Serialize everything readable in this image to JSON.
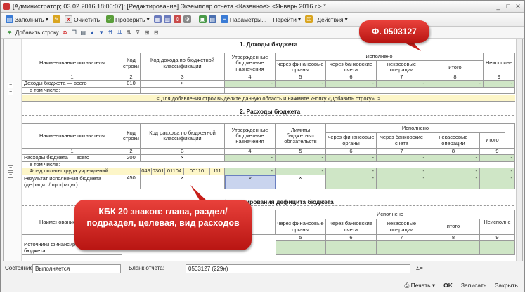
{
  "window": {
    "title": "[Администратор; 03.02.2016 18:06:07]: [Редактирование] Экземпляр отчета <Казенное> <Январь 2016 г.> *"
  },
  "toolbar": {
    "fill": "Заполнить",
    "clear": "Очистить",
    "check": "Проверить",
    "params": "Параметры...",
    "goto": "Перейти",
    "actions": "Действия"
  },
  "subtoolbar": {
    "add_row": "Добавить строку"
  },
  "sections": {
    "s1": "1. Доходы бюджета",
    "s2": "2. Расходы бюджета",
    "s3": "3. Источники финансирования дефицита бюджета"
  },
  "headers": {
    "name": "Наименование показателя",
    "code_line": "Код строки",
    "income_code": "Код дохода по бюджетной классификации",
    "expense_code": "Код расхода по бюджетной классификации",
    "approved": "Утвержденные бюджетные назначения",
    "limits": "Лимиты бюджетных обязательств",
    "executed": "Исполнено",
    "via_fin": "через финансовые органы",
    "via_bank": "через банковские счета",
    "noncash": "некассовые операции",
    "total": "итого",
    "unexecuted": "Неисполне"
  },
  "colnums1": [
    "1",
    "2",
    "3",
    "4",
    "5",
    "6",
    "7",
    "8",
    "9"
  ],
  "income": {
    "total_name": "Доходы бюджета — всего",
    "total_code": "010",
    "code_x": "×",
    "incl": "в том числе:",
    "hint": "< Для добавления строк выделите данную область и нажмите кнопку «Добавить строку». >",
    "dash": "-"
  },
  "expense": {
    "total_name": "Расходы бюджета — всего",
    "total_code": "200",
    "code_x": "×",
    "incl": "в том числе:",
    "fot_name": "Фонд оплаты труда учреждений",
    "kbk": [
      "049",
      "0301",
      "01104",
      "00110",
      "111"
    ],
    "result_name": "Результат исполнения бюджета (дефицит / профицит)",
    "result_code": "450",
    "x": "×",
    "dash": "-"
  },
  "sources": {
    "name": "Источники финансирования дефицита бюджета"
  },
  "status": {
    "state_label": "Состояние",
    "state_value": "Выполняется",
    "form_label": "Бланк отчета:",
    "form_value": "0503127 (229н)",
    "sigma": "Σ="
  },
  "bottom": {
    "print": "Печать",
    "ok": "OK",
    "save": "Записать",
    "close": "Закрыть"
  },
  "callouts": {
    "form": "Ф. 0503127",
    "kbk": "КБК 20 знаков: глава, раздел/подраздел, целевая, вид расходов"
  },
  "colors": {
    "green": "#cfe6c6",
    "yellow": "#fdf6c8",
    "blue": "#c9d4ee",
    "callout": "#d42a25"
  }
}
